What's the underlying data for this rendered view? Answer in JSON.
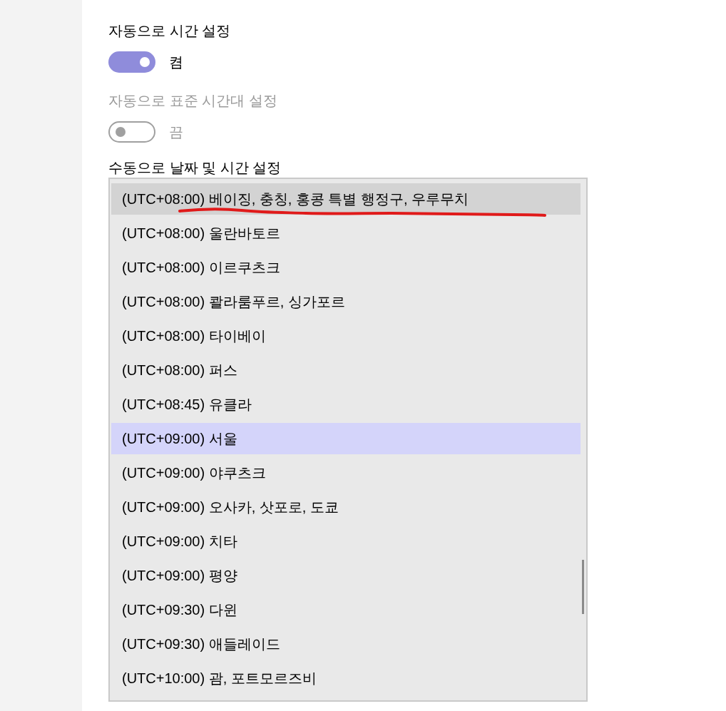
{
  "settings": [
    {
      "title": "자동으로 시간 설정",
      "on": true,
      "state_label": "켬",
      "disabled": false
    },
    {
      "title": "자동으로 표준 시간대 설정",
      "on": false,
      "state_label": "끔",
      "disabled": true
    }
  ],
  "manual_section": {
    "title": "수동으로 날짜 및 시간 설정"
  },
  "timezone_list": {
    "items": [
      {
        "label": "(UTC+08:00) 베이징, 충칭, 홍콩 특별 행정구, 우루무치",
        "selected": false,
        "hovered": true,
        "underlined": true
      },
      {
        "label": "(UTC+08:00) 울란바토르",
        "selected": false,
        "hovered": false,
        "underlined": false
      },
      {
        "label": "(UTC+08:00) 이르쿠츠크",
        "selected": false,
        "hovered": false,
        "underlined": false
      },
      {
        "label": "(UTC+08:00) 콸라룸푸르, 싱가포르",
        "selected": false,
        "hovered": false,
        "underlined": false
      },
      {
        "label": "(UTC+08:00) 타이베이",
        "selected": false,
        "hovered": false,
        "underlined": false
      },
      {
        "label": "(UTC+08:00) 퍼스",
        "selected": false,
        "hovered": false,
        "underlined": false
      },
      {
        "label": "(UTC+08:45) 유클라",
        "selected": false,
        "hovered": false,
        "underlined": false
      },
      {
        "label": "(UTC+09:00) 서울",
        "selected": true,
        "hovered": false,
        "underlined": false
      },
      {
        "label": "(UTC+09:00) 야쿠츠크",
        "selected": false,
        "hovered": false,
        "underlined": false
      },
      {
        "label": "(UTC+09:00) 오사카, 삿포로, 도쿄",
        "selected": false,
        "hovered": false,
        "underlined": false
      },
      {
        "label": "(UTC+09:00) 치타",
        "selected": false,
        "hovered": false,
        "underlined": false
      },
      {
        "label": "(UTC+09:00) 평양",
        "selected": false,
        "hovered": false,
        "underlined": false
      },
      {
        "label": "(UTC+09:30) 다윈",
        "selected": false,
        "hovered": false,
        "underlined": false
      },
      {
        "label": "(UTC+09:30) 애들레이드",
        "selected": false,
        "hovered": false,
        "underlined": false
      },
      {
        "label": "(UTC+10:00) 괌, 포트모르즈비",
        "selected": false,
        "hovered": false,
        "underlined": false
      }
    ]
  }
}
